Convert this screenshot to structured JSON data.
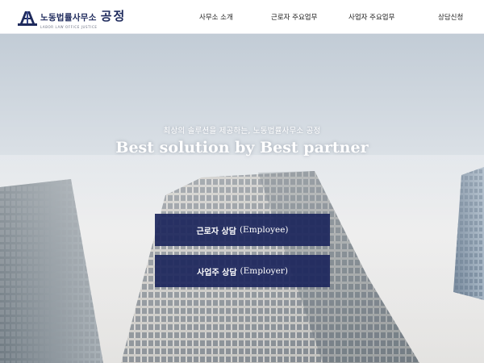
{
  "brand": {
    "name_kr": "노동법률사무소",
    "brand_kr": "공정",
    "subtitle": "LABOR LAW OFFICE JUSTICE",
    "logo_icon": "scales-logo-icon"
  },
  "nav": {
    "items": [
      {
        "label": "사무소 소개"
      },
      {
        "label": "근로자 주요업무"
      },
      {
        "label": "사업자 주요업무"
      },
      {
        "label": "상담신청"
      }
    ]
  },
  "hero": {
    "tagline_kr": "최상의 솔루션을 제공하는, 노동법률사무소 공정",
    "tagline_en": "Best solution by Best partner"
  },
  "cta": {
    "employee": {
      "label_kr": "근로자 상담",
      "label_en": "(Employee)"
    },
    "employer": {
      "label_kr": "사업주 상담",
      "label_en": "(Employer)"
    }
  },
  "colors": {
    "primary": "#1c265c",
    "header_bg": "#ffffff",
    "hero_text": "#ffffff"
  }
}
